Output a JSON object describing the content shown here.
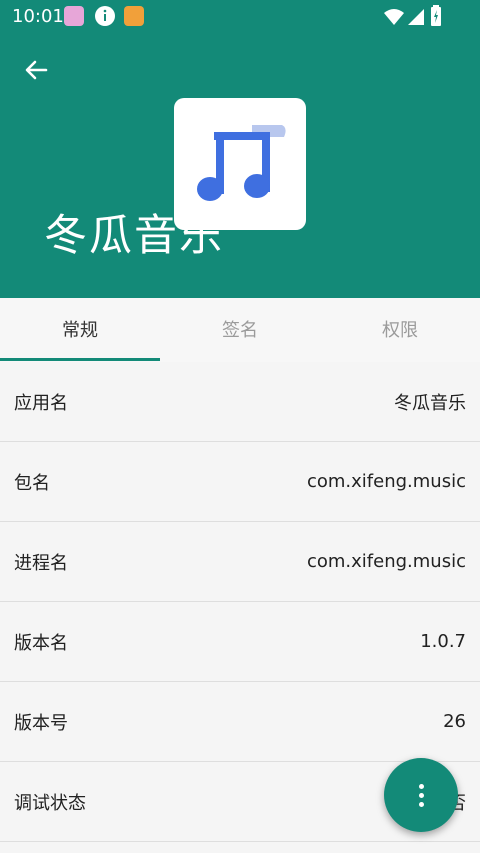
{
  "status_bar": {
    "time": "10:01",
    "icons": [
      "home-app-icon",
      "info-icon",
      "tv-app-icon",
      "wifi-icon",
      "signal-icon",
      "battery-icon"
    ]
  },
  "header": {
    "title": "冬瓜音乐",
    "background": "#138a78",
    "app_icon": "music-note-icon"
  },
  "tabs": [
    {
      "label": "常规",
      "active": true
    },
    {
      "label": "签名",
      "active": false
    },
    {
      "label": "权限",
      "active": false
    }
  ],
  "rows": [
    {
      "label": "应用名",
      "value": "冬瓜音乐"
    },
    {
      "label": "包名",
      "value": "com.xifeng.music"
    },
    {
      "label": "进程名",
      "value": "com.xifeng.music"
    },
    {
      "label": "版本名",
      "value": "1.0.7"
    },
    {
      "label": "版本号",
      "value": "26"
    },
    {
      "label": "调试状态",
      "value": "否"
    }
  ],
  "fab": {
    "icon": "more-vertical-icon"
  }
}
